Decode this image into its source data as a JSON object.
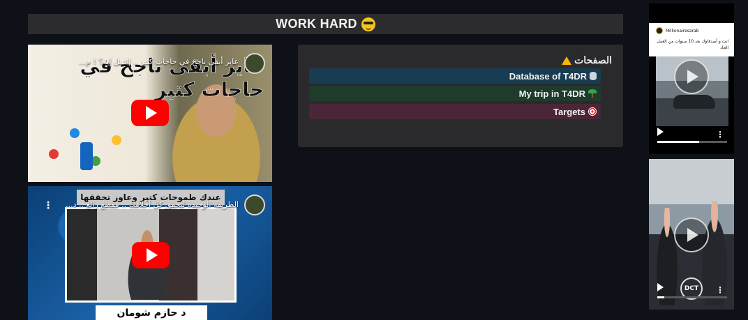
{
  "header": {
    "title": "WORK HARD",
    "emoji_icon": "sunglasses-face-icon"
  },
  "videos": [
    {
      "title": "عايز أبقى ناجح في حاجات كتير .. إعمل إيه؟ ! م...",
      "overlay_text": "عايز أبقى ناجح في حاجات كتير",
      "play_icon": "youtube-play-icon"
    },
    {
      "title": "الطريقة الوحيدة لتحقق كل أحلامك .. مقطع رائع .. د...",
      "banner_text": "عندك طموحات كتير وعاوز تحققها",
      "name_text": "د حازم شومان",
      "play_icon": "youtube-play-icon"
    }
  ],
  "pages": {
    "heading": "الصفحات",
    "heading_icon": "warning-icon",
    "items": [
      {
        "label": "Database of T4DR",
        "icon": "database-icon",
        "color": "#183c52"
      },
      {
        "label": "My trip in T4DR",
        "icon": "palm-tree-icon",
        "color": "#1f3b2c"
      },
      {
        "label": "Targets",
        "icon": "target-icon",
        "color": "#4a2638"
      }
    ]
  },
  "shorts": [
    {
      "channel": "Millionairesarab",
      "caption": "انت و أصدقاؤك بعد 10 سنوات من العمل الجاد",
      "progress": 0.6
    },
    {
      "watermark": "DCT",
      "progress": 0.1
    }
  ]
}
